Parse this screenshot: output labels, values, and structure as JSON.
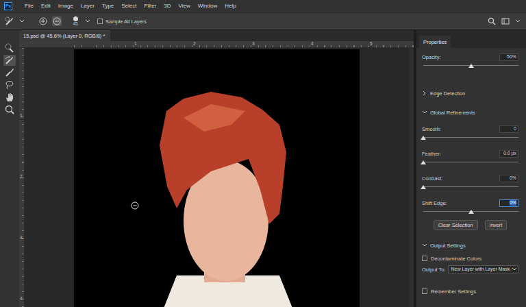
{
  "app": {
    "logo": "Ps"
  },
  "menu": [
    "File",
    "Edit",
    "Image",
    "Layer",
    "Type",
    "Select",
    "Filter",
    "3D",
    "View",
    "Window",
    "Help"
  ],
  "options_bar": {
    "modes": [
      {
        "selected": false
      },
      {
        "selected": true
      }
    ],
    "brush_size": "45",
    "sample_all_layers": {
      "label": "Sample All Layers",
      "checked": false
    }
  },
  "tools": [
    {
      "selected": false
    },
    {
      "selected": true
    },
    {
      "selected": false
    },
    {
      "selected": false
    },
    {
      "selected": false
    },
    {
      "selected": false
    }
  ],
  "document": {
    "tab": "15.psd @ 45.6% (Layer 0, RGB/8) *",
    "rulers": {
      "horizontal": [
        "1",
        "2",
        "3",
        "4",
        "5"
      ],
      "vertical": [
        "1",
        "2",
        "3",
        "4"
      ]
    }
  },
  "properties": {
    "title": "Properties",
    "rows": [
      {
        "kind": "slider",
        "label": "Opacity:",
        "value": "50%",
        "level": 0.5,
        "selected": false
      },
      {
        "kind": "section",
        "label": "Edge Detection",
        "expanded": false
      },
      {
        "kind": "section",
        "label": "Global Refinements",
        "expanded": true
      },
      {
        "kind": "slider",
        "label": "Smooth:",
        "value": "0",
        "level": 0,
        "selected": false
      },
      {
        "kind": "slider",
        "label": "Feather:",
        "value": "0.0 px",
        "level": 0,
        "selected": false
      },
      {
        "kind": "slider",
        "label": "Contrast:",
        "value": "0%",
        "level": 0,
        "selected": false
      },
      {
        "kind": "slider",
        "label": "Shift Edge:",
        "value": "0%",
        "level": 0.5,
        "selected": true
      },
      {
        "kind": "buttons",
        "buttons": [
          "Clear Selection",
          "Invert"
        ]
      },
      {
        "kind": "section",
        "label": "Output Settings",
        "expanded": true
      },
      {
        "kind": "checkbox",
        "label": "Decontaminate Colors",
        "checked": false
      },
      {
        "kind": "select",
        "label": "Output To:",
        "value": "New Layer with Layer Mask"
      },
      {
        "kind": "checkbox",
        "label": "Remember Settings",
        "checked": false
      }
    ]
  }
}
